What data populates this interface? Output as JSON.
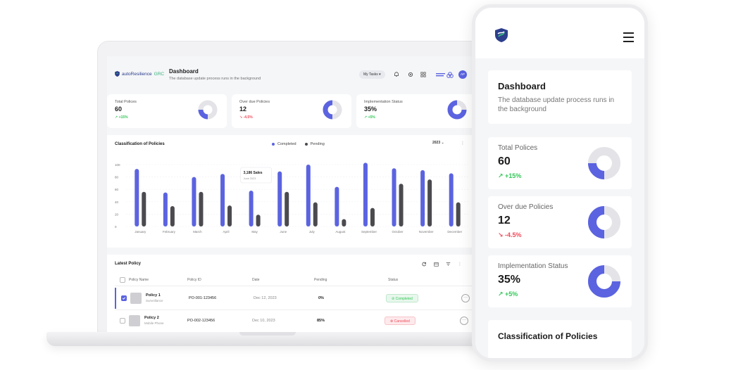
{
  "brand": {
    "name_prefix": "autoResilience",
    "name_suffix": "GRC"
  },
  "header": {
    "title": "Dashboard",
    "subtitle": "The database update process runs in the background",
    "my_tasks_label": "My Tasks ▾",
    "avatar_initials": "AP"
  },
  "stats": [
    {
      "label": "Total Polices",
      "value": "60",
      "delta": "+15%",
      "trend": "up",
      "fraction": 0.25
    },
    {
      "label": "Over due Policies",
      "value": "12",
      "delta": "-4.5%",
      "trend": "down",
      "fraction": 0.5
    },
    {
      "label": "Implementation Status",
      "value": "35%",
      "delta": "+5%",
      "trend": "up",
      "fraction": 0.75
    }
  ],
  "chart": {
    "title": "Classification of Policies",
    "legend_completed": "Completed",
    "legend_pending": "Pending",
    "year": "2023 ⌄",
    "tooltip_value": "3,186 Sales",
    "tooltip_date": "June 2023"
  },
  "chart_data": {
    "type": "bar",
    "categories": [
      "January",
      "February",
      "March",
      "April",
      "May",
      "June",
      "July",
      "August",
      "September",
      "October",
      "November",
      "December"
    ],
    "series": [
      {
        "name": "Completed",
        "values": [
          93,
          55,
          80,
          85,
          58,
          89,
          100,
          64,
          103,
          94,
          91,
          86
        ]
      },
      {
        "name": "Pending",
        "values": [
          56,
          33,
          56,
          34,
          19,
          56,
          39,
          12,
          30,
          69,
          76,
          39
        ]
      }
    ],
    "yticks": [
      "100",
      "80",
      "60",
      "40",
      "20",
      "0"
    ],
    "ylim": [
      0,
      100
    ],
    "colors": {
      "completed": "#5b63e0",
      "pending": "#4a4a4f"
    }
  },
  "policy": {
    "title": "Latest Policy",
    "columns": {
      "name": "Policy Name",
      "id": "Policy ID",
      "date": "Date",
      "pending": "Pending",
      "status": "Status"
    },
    "rows": [
      {
        "name": "Policy 1",
        "owner": "Surveillance",
        "id": "PO-001-123456",
        "date": "Dec 12, 2023",
        "pending": "0%",
        "status": "Completed",
        "checked": true
      },
      {
        "name": "Policy 2",
        "owner": "Mobile Phone",
        "id": "PO-002-123456",
        "date": "Dec 10, 2023",
        "pending": "85%",
        "status": "Cancelled",
        "checked": false
      }
    ]
  },
  "mobile": {
    "title": "Dashboard",
    "subtitle": "The database update process runs in the background",
    "stats": [
      {
        "label": "Total Polices",
        "value": "60",
        "delta": "+15%"
      },
      {
        "label": "Over due Policies",
        "value": "12",
        "delta": "-4.5%"
      },
      {
        "label": "Implementation Status",
        "value": "35%",
        "delta": "+5%"
      }
    ],
    "classification_title": "Classification of Policies"
  },
  "colors": {
    "accent": "#5b63e0",
    "track": "#e4e4e8",
    "positive": "#34c759",
    "negative": "#ef4b5b"
  }
}
